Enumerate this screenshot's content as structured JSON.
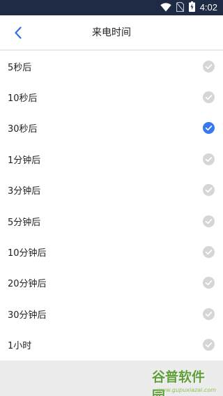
{
  "status_bar": {
    "time": "4:02"
  },
  "header": {
    "title": "来电时间"
  },
  "options": [
    {
      "label": "5秒后",
      "selected": false
    },
    {
      "label": "10秒后",
      "selected": false
    },
    {
      "label": "30秒后",
      "selected": true
    },
    {
      "label": "1分钟后",
      "selected": false
    },
    {
      "label": "3分钟后",
      "selected": false
    },
    {
      "label": "5分钟后",
      "selected": false
    },
    {
      "label": "10分钟后",
      "selected": false
    },
    {
      "label": "20分钟后",
      "selected": false
    },
    {
      "label": "30分钟后",
      "selected": false
    },
    {
      "label": "1小时",
      "selected": false
    }
  ],
  "colors": {
    "selected": "#3a78f2",
    "unselected": "#d6d6d6",
    "accent": "#2f6fe0"
  },
  "watermark": {
    "text": "谷普软件园",
    "url": "www.gupuxiazai.com"
  }
}
